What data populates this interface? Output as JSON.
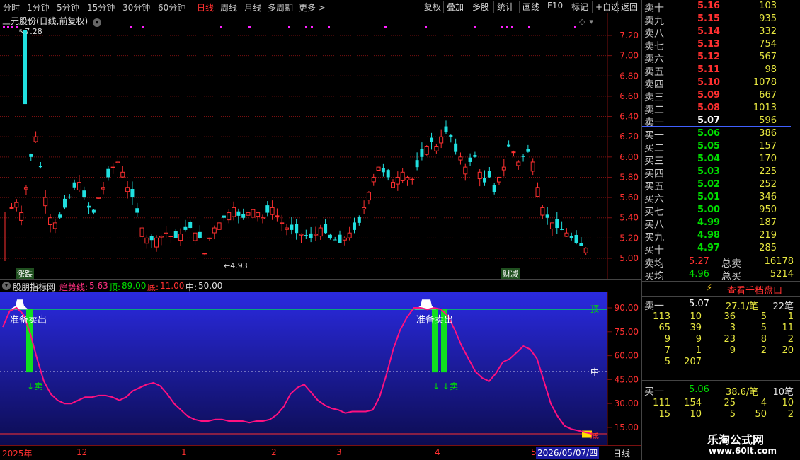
{
  "toolbar": {
    "periods": [
      "分时",
      "1分钟",
      "5分钟",
      "15分钟",
      "30分钟",
      "60分钟",
      "日线",
      "周线",
      "月线",
      "多周期",
      "更多"
    ],
    "active_period": "日线",
    "more_arrow": ">",
    "actions": [
      "复权",
      "叠加",
      "多股",
      "统计",
      "画线",
      "F10",
      "标记",
      "+自选",
      "返回"
    ]
  },
  "main_chart": {
    "title": "三元股份(日线,前复权)",
    "high_label": "7.28",
    "low_label": "4.93",
    "badge_left": "涨跌",
    "badge_right": "财减",
    "price_ticks": [
      "7.20",
      "7.00",
      "6.80",
      "6.60",
      "6.40",
      "6.20",
      "6.00",
      "5.80",
      "5.60",
      "5.40",
      "5.20",
      "5.00"
    ],
    "colors": {
      "up": "#ff3030",
      "down": "#20e0e0",
      "grid": "#7a1010"
    }
  },
  "indicator": {
    "name": "股朋指标网",
    "trend_label": "趋势线:",
    "trend_value": "5.63",
    "top_label": "顶:",
    "top_value": "89.00",
    "bottom_label": "底:",
    "bottom_value": "11.00",
    "mid_label": "中:",
    "mid_value": "50.00",
    "ticks": [
      "90.00",
      "75.00",
      "60.00",
      "45.00",
      "30.00",
      "15.00"
    ],
    "line_label_top": "顶",
    "line_label_mid": "中",
    "line_label_bottom": "底",
    "signal_text": "准备卖出",
    "sell_text": "卖",
    "line_values": [
      78,
      88,
      90,
      86,
      74,
      58,
      44,
      36,
      32,
      30,
      30,
      32,
      34,
      34,
      35,
      35,
      34,
      32,
      34,
      38,
      40,
      42,
      43,
      41,
      36,
      30,
      26,
      22,
      20,
      19,
      19,
      20,
      20,
      19,
      19,
      19,
      18,
      19,
      19,
      20,
      23,
      28,
      36,
      40,
      42,
      37,
      32,
      29,
      27,
      26,
      24,
      25,
      25,
      25,
      26,
      34,
      48,
      64,
      76,
      84,
      90,
      90,
      89,
      90,
      89,
      85,
      76,
      66,
      58,
      50,
      46,
      44,
      49,
      56,
      58,
      62,
      66,
      64,
      58,
      44,
      30,
      22,
      16,
      14,
      13,
      12,
      11
    ]
  },
  "time_axis": {
    "labels": [
      "2025年",
      "12",
      "1",
      "2",
      "3",
      "4",
      "5"
    ],
    "date_cursor": "2026/05/07/四",
    "period": "日线"
  },
  "order_book": {
    "asks": [
      {
        "label": "卖十",
        "price": "5.16",
        "vol": "103"
      },
      {
        "label": "卖九",
        "price": "5.15",
        "vol": "935"
      },
      {
        "label": "卖八",
        "price": "5.14",
        "vol": "332"
      },
      {
        "label": "卖七",
        "price": "5.13",
        "vol": "754"
      },
      {
        "label": "卖六",
        "price": "5.12",
        "vol": "567"
      },
      {
        "label": "卖五",
        "price": "5.11",
        "vol": "98"
      },
      {
        "label": "卖四",
        "price": "5.10",
        "vol": "1078"
      },
      {
        "label": "卖三",
        "price": "5.09",
        "vol": "667"
      },
      {
        "label": "卖二",
        "price": "5.08",
        "vol": "1013"
      },
      {
        "label": "卖一",
        "price": "5.07",
        "vol": "596"
      }
    ],
    "bids": [
      {
        "label": "买一",
        "price": "5.06",
        "vol": "386"
      },
      {
        "label": "买二",
        "price": "5.05",
        "vol": "157"
      },
      {
        "label": "买三",
        "price": "5.04",
        "vol": "170"
      },
      {
        "label": "买四",
        "price": "5.03",
        "vol": "225"
      },
      {
        "label": "买五",
        "price": "5.02",
        "vol": "252"
      },
      {
        "label": "买六",
        "price": "5.01",
        "vol": "346"
      },
      {
        "label": "买七",
        "price": "5.00",
        "vol": "950"
      },
      {
        "label": "买八",
        "price": "4.99",
        "vol": "187"
      },
      {
        "label": "买九",
        "price": "4.98",
        "vol": "219"
      },
      {
        "label": "买十",
        "price": "4.97",
        "vol": "285"
      }
    ],
    "avg_ask_label": "卖均",
    "avg_ask": "5.27",
    "total_ask_label": "总卖",
    "total_ask": "16178",
    "avg_bid_label": "买均",
    "avg_bid": "4.96",
    "total_bid_label": "总买",
    "total_bid": "5214",
    "depth_button": "查看千档盘口",
    "ask1_label": "卖一",
    "ask1_price": "5.07",
    "ask1_per": "27.1/笔",
    "ask1_count": "22笔",
    "ask_queue": [
      [
        "113",
        "10",
        "36",
        "5",
        "1"
      ],
      [
        "65",
        "39",
        "3",
        "5",
        "11"
      ],
      [
        "9",
        "9",
        "23",
        "8",
        "2"
      ],
      [
        "7",
        "1",
        "9",
        "2",
        "20"
      ],
      [
        "5",
        "207",
        "",
        "",
        ""
      ]
    ],
    "bid1_label": "买一",
    "bid1_price": "5.06",
    "bid1_per": "38.6/笔",
    "bid1_count": "10笔",
    "bid_queue": [
      [
        "111",
        "154",
        "25",
        "4",
        "10"
      ],
      [
        "15",
        "10",
        "5",
        "50",
        "2"
      ]
    ],
    "watermark_title": "乐淘公式网",
    "watermark_url": "www.60lt.com"
  }
}
